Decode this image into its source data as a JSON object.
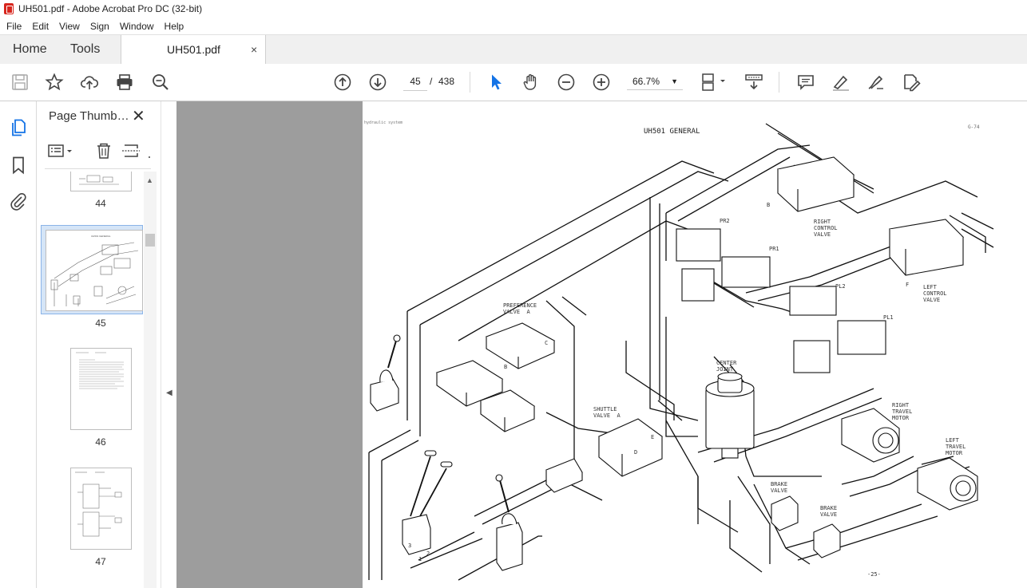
{
  "window": {
    "title": "UH501.pdf - Adobe Acrobat Pro DC (32-bit)"
  },
  "menu": [
    "File",
    "Edit",
    "View",
    "Sign",
    "Window",
    "Help"
  ],
  "tabs": {
    "home": "Home",
    "tools": "Tools",
    "document": "UH501.pdf",
    "close_glyph": "×"
  },
  "toolbar": {
    "current_page": "45",
    "separator": "/",
    "total_pages": "438",
    "zoom": "66.7%"
  },
  "icons": {
    "save": "save-icon",
    "bookmark_star": "star-icon",
    "upload": "upload-cloud-icon",
    "print": "printer-icon",
    "search": "zoom-search-icon",
    "prev_page": "arrow-up-circle-icon",
    "next_page": "arrow-down-circle-icon",
    "select": "cursor-arrow-icon",
    "hand": "hand-icon",
    "zoom_out": "minus-circle-icon",
    "zoom_in": "plus-circle-icon",
    "fit": "fit-page-icon",
    "scroll_mode": "scroll-mode-icon",
    "comment": "comment-icon",
    "highlight": "pen-icon",
    "sign": "sign-icon",
    "edit": "edit-pdf-icon"
  },
  "panel": {
    "title": "Page Thumb…",
    "thumbnails": [
      {
        "label": "44"
      },
      {
        "label": "45",
        "selected": true
      },
      {
        "label": "46"
      },
      {
        "label": "47"
      }
    ]
  },
  "document": {
    "header": "UH501 GENERAL",
    "page_code": "G-74",
    "page_footer": "-25-",
    "corner_text": "hydraulic system",
    "labels": {
      "right_control_valve": "RIGHT\nCONTROL\nVALVE",
      "left_control_valve": "LEFT\nCONTROL\nVALVE",
      "preference_valve": "PREFERENCE\nVALVE  A",
      "shuttle_valve": "SHUTTLE\nVALVE  A",
      "center_joint": "CENTER\nJOINT",
      "right_travel_motor": "RIGHT\nTRAVEL\nMOTOR",
      "left_travel_motor": "LEFT\nTRAVEL\nMOTOR",
      "brake_valve_1": "BRAKE\nVALVE",
      "brake_valve_2": "BRAKE\nVALVE",
      "pr2": "PR2",
      "pr1": "PR1",
      "pl2": "PL2",
      "pl1": "PL1",
      "port_b1": "B",
      "port_c": "C",
      "port_b2": "B",
      "port_e": "E",
      "port_d": "D",
      "port_f": "F",
      "num_1": "1",
      "num_2": "2",
      "num_3": "3"
    }
  }
}
